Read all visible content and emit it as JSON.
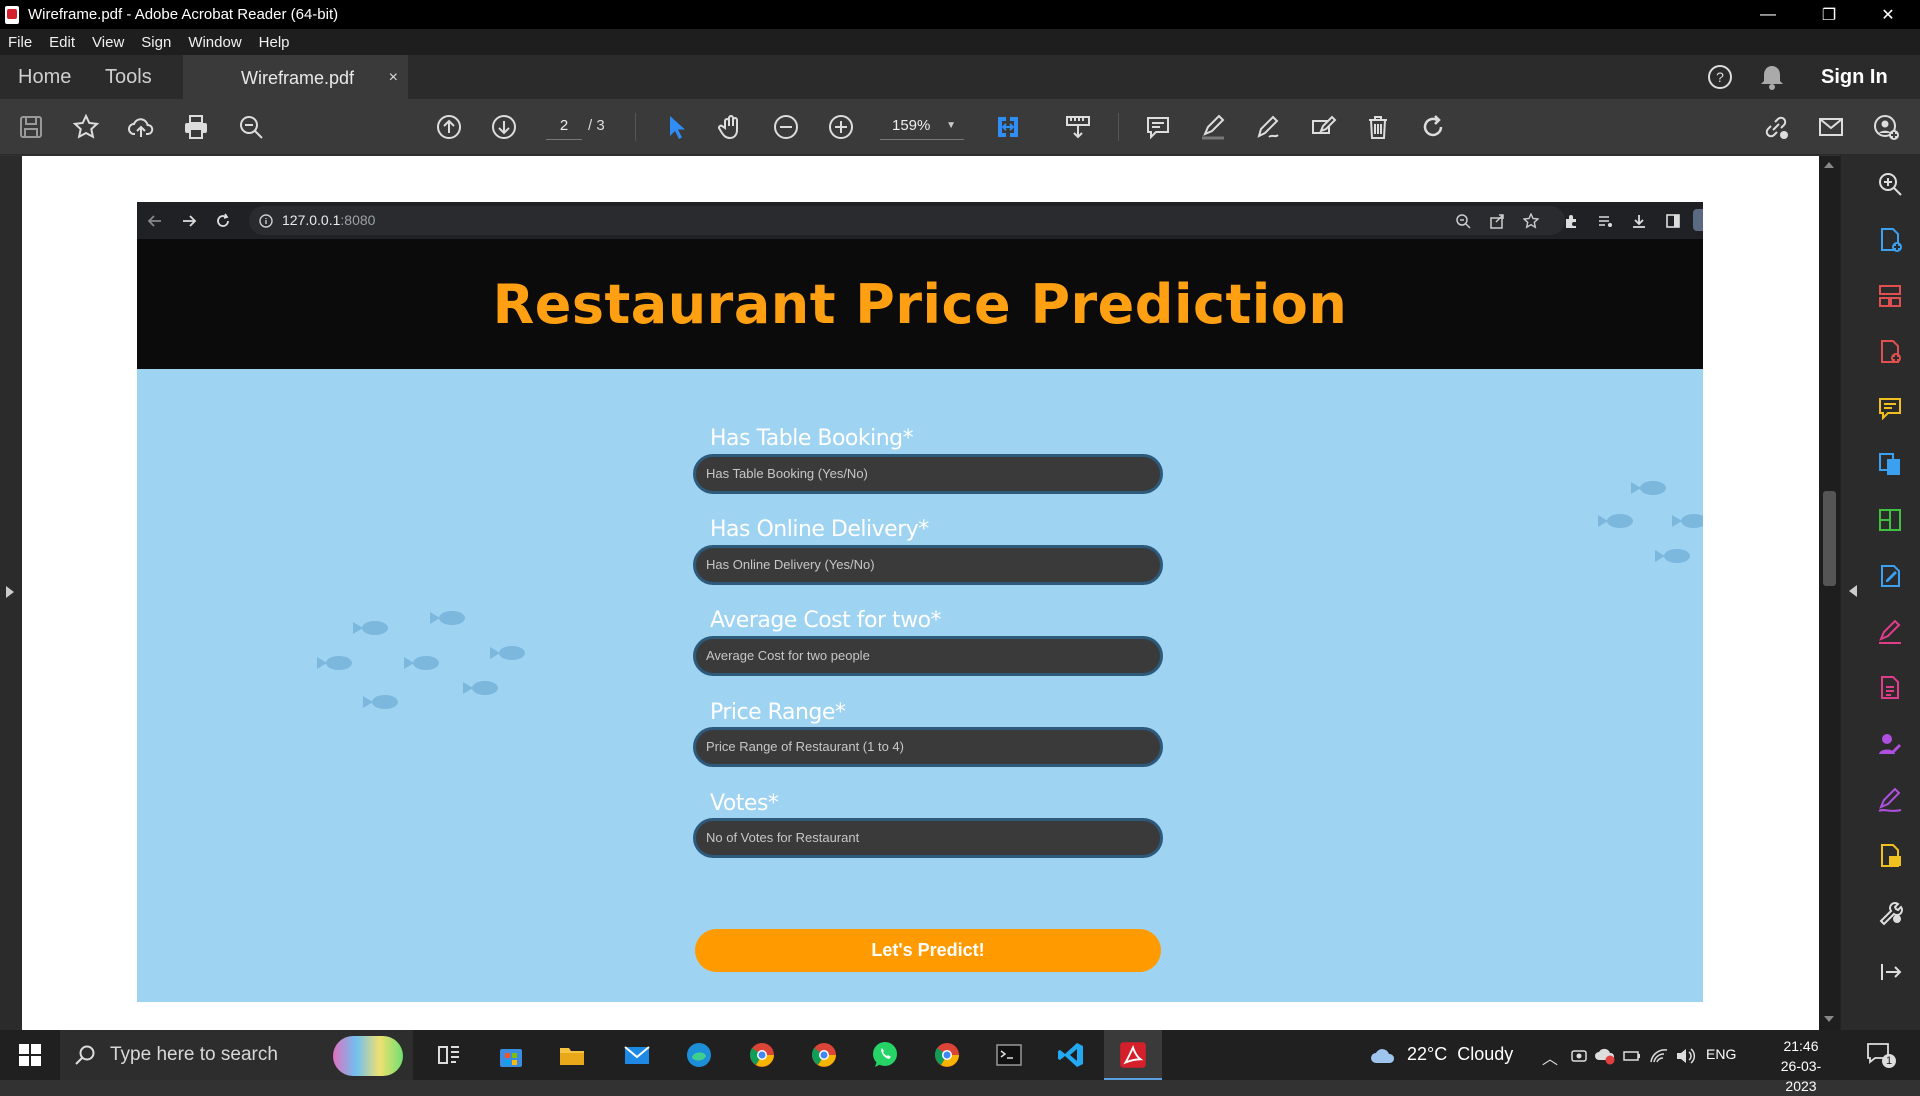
{
  "window": {
    "title": "Wireframe.pdf - Adobe Acrobat Reader (64-bit)",
    "minimize": "—",
    "restore": "❐",
    "close": "✕"
  },
  "menu": [
    "File",
    "Edit",
    "View",
    "Sign",
    "Window",
    "Help"
  ],
  "tabs": {
    "home": "Home",
    "tools": "Tools",
    "document": "Wireframe.pdf",
    "close": "×",
    "sign_in": "Sign In"
  },
  "toolbar": {
    "current_page": "2",
    "total_pages": "/ 3",
    "zoom": "159%"
  },
  "browser": {
    "url_host": "127.0.0.1",
    "url_port": ":8080"
  },
  "site": {
    "title": "Restaurant Price Prediction",
    "fields": [
      {
        "label": "Has Table Booking*",
        "placeholder": "Has Table Booking (Yes/No)"
      },
      {
        "label": "Has Online Delivery*",
        "placeholder": "Has Online Delivery (Yes/No)"
      },
      {
        "label": "Average Cost for two*",
        "placeholder": "Average Cost for two people"
      },
      {
        "label": "Price Range*",
        "placeholder": "Price Range of Restaurant (1 to 4)"
      },
      {
        "label": "Votes*",
        "placeholder": "No of Votes for Restaurant"
      }
    ],
    "button": "Let's Predict!"
  },
  "taskbar": {
    "search_placeholder": "Type here to search",
    "weather": "22°C  Cloudy",
    "lang": "ENG",
    "time": "21:46",
    "date": "26-03-2023",
    "notifications": "1"
  },
  "colors": {
    "accent_orange": "#ffa012",
    "page_bg": "#9fd3f2",
    "acrobat_red": "#d4202a",
    "tool_blue": "#2f8df5",
    "rail_pink": "#e03c8c"
  }
}
